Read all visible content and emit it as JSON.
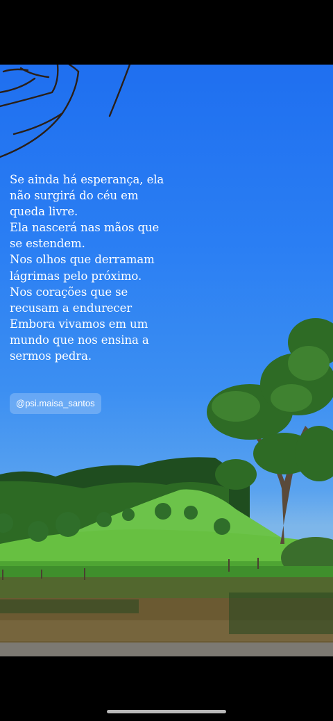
{
  "story": {
    "quote_text": "Se ainda há esperança, ela\nnão surgirá do céu em\nqueda livre.\nEla nascerá nas mãos que\nse estendem.\nNos olhos que derramam\nlágrimas pelo próximo.\nNos corações que se\nrecusam a endurecer\nEmbora vivamos em um\nmundo que nos ensina a\nsermos pedra.",
    "mention": "@psi.maisa_santos",
    "background_photo": "blue sky over green pasture, trees and pond"
  },
  "colors": {
    "sky_top": "#1f6ff0",
    "grass": "#5fbf3a",
    "water": "#6b5a32"
  }
}
